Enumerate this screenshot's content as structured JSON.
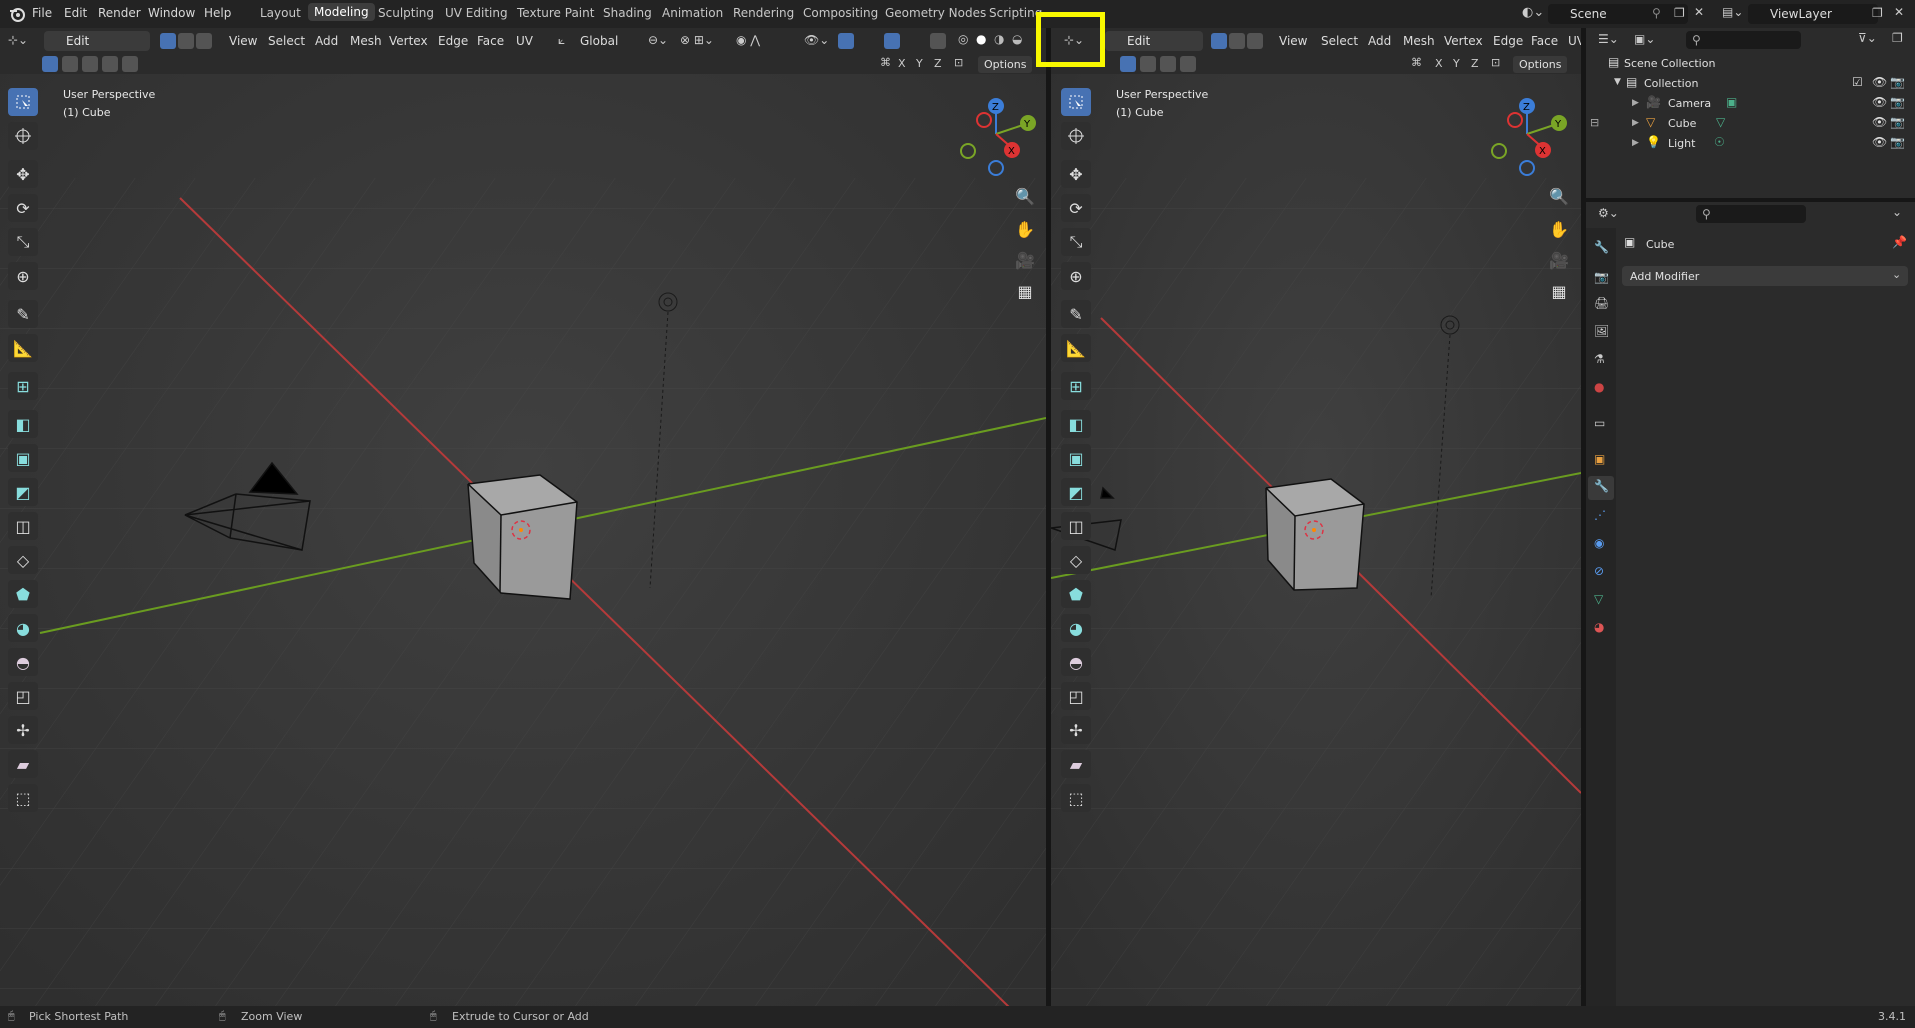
{
  "menus": [
    "File",
    "Edit",
    "Render",
    "Window",
    "Help"
  ],
  "workspaces": [
    "Layout",
    "Modeling",
    "Sculpting",
    "UV Editing",
    "Texture Paint",
    "Shading",
    "Animation",
    "Rendering",
    "Compositing",
    "Geometry Nodes",
    "Scripting"
  ],
  "active_workspace": "Modeling",
  "scene": "Scene",
  "view_layer": "ViewLayer",
  "viewport_left": {
    "mode": "Edit Mode",
    "menus": [
      "View",
      "Select",
      "Add",
      "Mesh",
      "Vertex",
      "Edge",
      "Face",
      "UV"
    ],
    "transform": "Global",
    "view_name": "User Perspective",
    "object": "(1) Cube",
    "options": "Options",
    "axes": [
      "X",
      "Y",
      "Z"
    ]
  },
  "viewport_right": {
    "mode": "Edit Mode",
    "menus": [
      "View",
      "Select",
      "Add",
      "Mesh",
      "Vertex",
      "Edge",
      "Face",
      "UV"
    ],
    "view_name": "User Perspective",
    "object": "(1) Cube",
    "options": "Options",
    "axes": [
      "X",
      "Y",
      "Z"
    ]
  },
  "gizmo": {
    "x": "X",
    "y": "Y",
    "z": "Z"
  },
  "outliner": {
    "root": "Scene Collection",
    "collection": "Collection",
    "items": [
      "Camera",
      "Cube",
      "Light"
    ]
  },
  "properties": {
    "object": "Cube",
    "add_modifier": "Add Modifier"
  },
  "status": {
    "left": "Pick Shortest Path",
    "middle": "Zoom View",
    "right": "Extrude to Cursor or Add",
    "version": "3.4.1"
  },
  "colors": {
    "accent": "#4772b3",
    "highlight": "#f8f800",
    "x_axis": "#c63a3a",
    "y_axis": "#6a9c20"
  }
}
